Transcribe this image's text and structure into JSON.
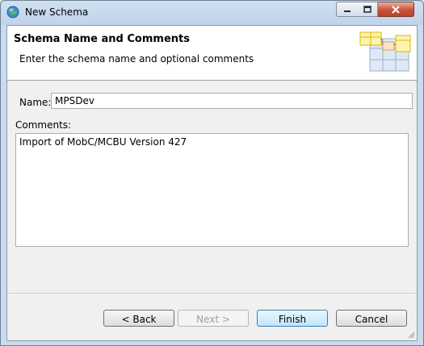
{
  "window": {
    "title": "New Schema",
    "icon": "globe-icon",
    "controls": {
      "minimize": "minimize-icon",
      "maximize": "maximize-icon",
      "close": "close-icon"
    }
  },
  "header": {
    "title": "Schema Name and Comments",
    "description": "Enter the schema name and optional comments",
    "image": "schema-tables-icon"
  },
  "form": {
    "name_label": "Name:",
    "name_value": "MPSDev",
    "comments_label": "Comments:",
    "comments_value": "Import of MobC/MCBU Version 427"
  },
  "buttons": {
    "back": "< Back",
    "next": "Next >",
    "finish": "Finish",
    "cancel": "Cancel"
  },
  "colors": {
    "accent": "#3c7fb1",
    "title_bar": "#c9dbef",
    "close_button": "#c8523a"
  }
}
